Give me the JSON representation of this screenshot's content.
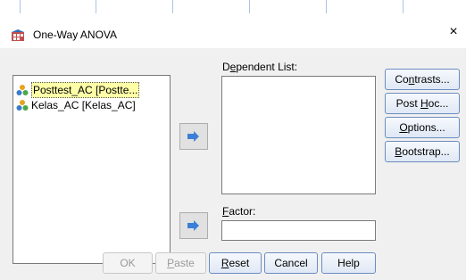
{
  "window": {
    "title": "One-Way ANOVA",
    "close_glyph": "×"
  },
  "variables": {
    "items": [
      {
        "label": "Posttest_AC [Postte...",
        "icon": "nominal-variable-icon",
        "selected": true
      },
      {
        "label": "Kelas_AC [Kelas_AC]",
        "icon": "nominal-variable-icon",
        "selected": false
      }
    ]
  },
  "dependent_list": {
    "label_pre": "D",
    "label_ul": "e",
    "label_post": "pendent List:"
  },
  "factor": {
    "label_ul": "F",
    "label_post": "actor:",
    "value": ""
  },
  "side_buttons": {
    "contrasts": {
      "pre": "Co",
      "ul": "n",
      "post": "trasts..."
    },
    "post_hoc": {
      "pre": "Post ",
      "ul": "H",
      "post": "oc..."
    },
    "options": {
      "pre": "",
      "ul": "O",
      "post": "ptions..."
    },
    "bootstrap": {
      "pre": "",
      "ul": "B",
      "post": "ootstrap..."
    }
  },
  "bottom_buttons": {
    "ok": "OK",
    "paste": {
      "ul": "P",
      "post": "aste"
    },
    "reset": {
      "ul": "R",
      "post": "eset"
    },
    "cancel": "Cancel",
    "help": "Help"
  },
  "colors": {
    "arrow": "#3c7fd6",
    "selection": "#ffffa8",
    "button_border": "#6c8cc0"
  }
}
